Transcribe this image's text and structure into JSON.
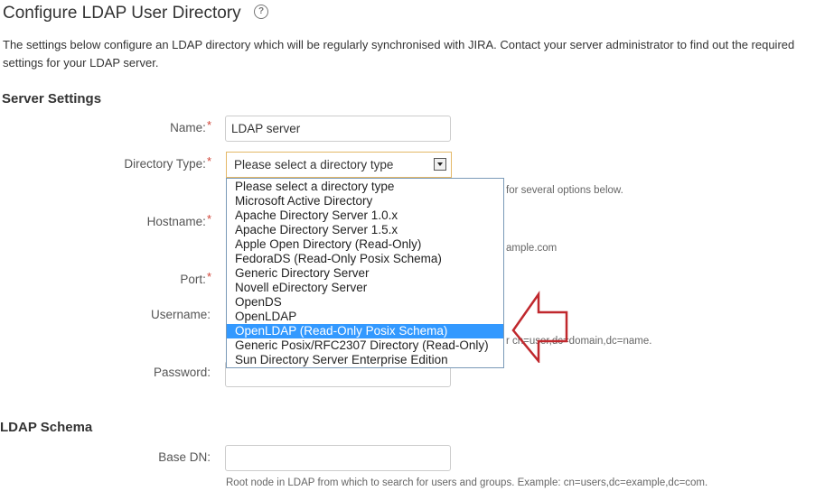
{
  "page": {
    "title": "Configure LDAP User Directory",
    "help_icon": "question-circle-icon",
    "intro": "The settings below configure an LDAP directory which will be regularly synchronised with JIRA. Contact your server administrator to find out the required settings for your LDAP server."
  },
  "server_settings": {
    "heading": "Server Settings",
    "name": {
      "label": "Name:",
      "required": "*",
      "value": "LDAP server"
    },
    "directory_type": {
      "label": "Directory Type:",
      "required": "*",
      "selected": "Please select a directory type",
      "hint": "for several options below.",
      "arrow_icon": "dropdown-arrow-icon"
    },
    "hostname": {
      "label": "Hostname:",
      "required": "*",
      "hint": "ample.com"
    },
    "port": {
      "label": "Port:",
      "required": "*"
    },
    "username": {
      "label": "Username:",
      "hint": "r cn=user,dc=domain,dc=name."
    },
    "password": {
      "label": "Password:"
    }
  },
  "dropdown": {
    "options": [
      "Please select a directory type",
      "Microsoft Active Directory",
      "Apache Directory Server 1.0.x",
      "Apache Directory Server 1.5.x",
      "Apple Open Directory (Read-Only)",
      "FedoraDS (Read-Only Posix Schema)",
      "Generic Directory Server",
      "Novell eDirectory Server",
      "OpenDS",
      "OpenLDAP",
      "OpenLDAP (Read-Only Posix Schema)",
      "Generic Posix/RFC2307 Directory (Read-Only)",
      "Sun Directory Server Enterprise Edition"
    ],
    "highlighted_option": "OpenLDAP (Read-Only Posix Schema)",
    "highlight_color": "#3399ff"
  },
  "annotation": {
    "arrow_icon": "left-arrow-annotation-icon",
    "color": "#c0282d"
  },
  "ldap_schema": {
    "heading": "LDAP Schema",
    "base_dn": {
      "label": "Base DN:",
      "value": "",
      "hint": "Root node in LDAP from which to search for users and groups. Example: cn=users,dc=example,dc=com."
    }
  },
  "colors": {
    "required": "#d04437",
    "select_border": "#e4b867"
  }
}
